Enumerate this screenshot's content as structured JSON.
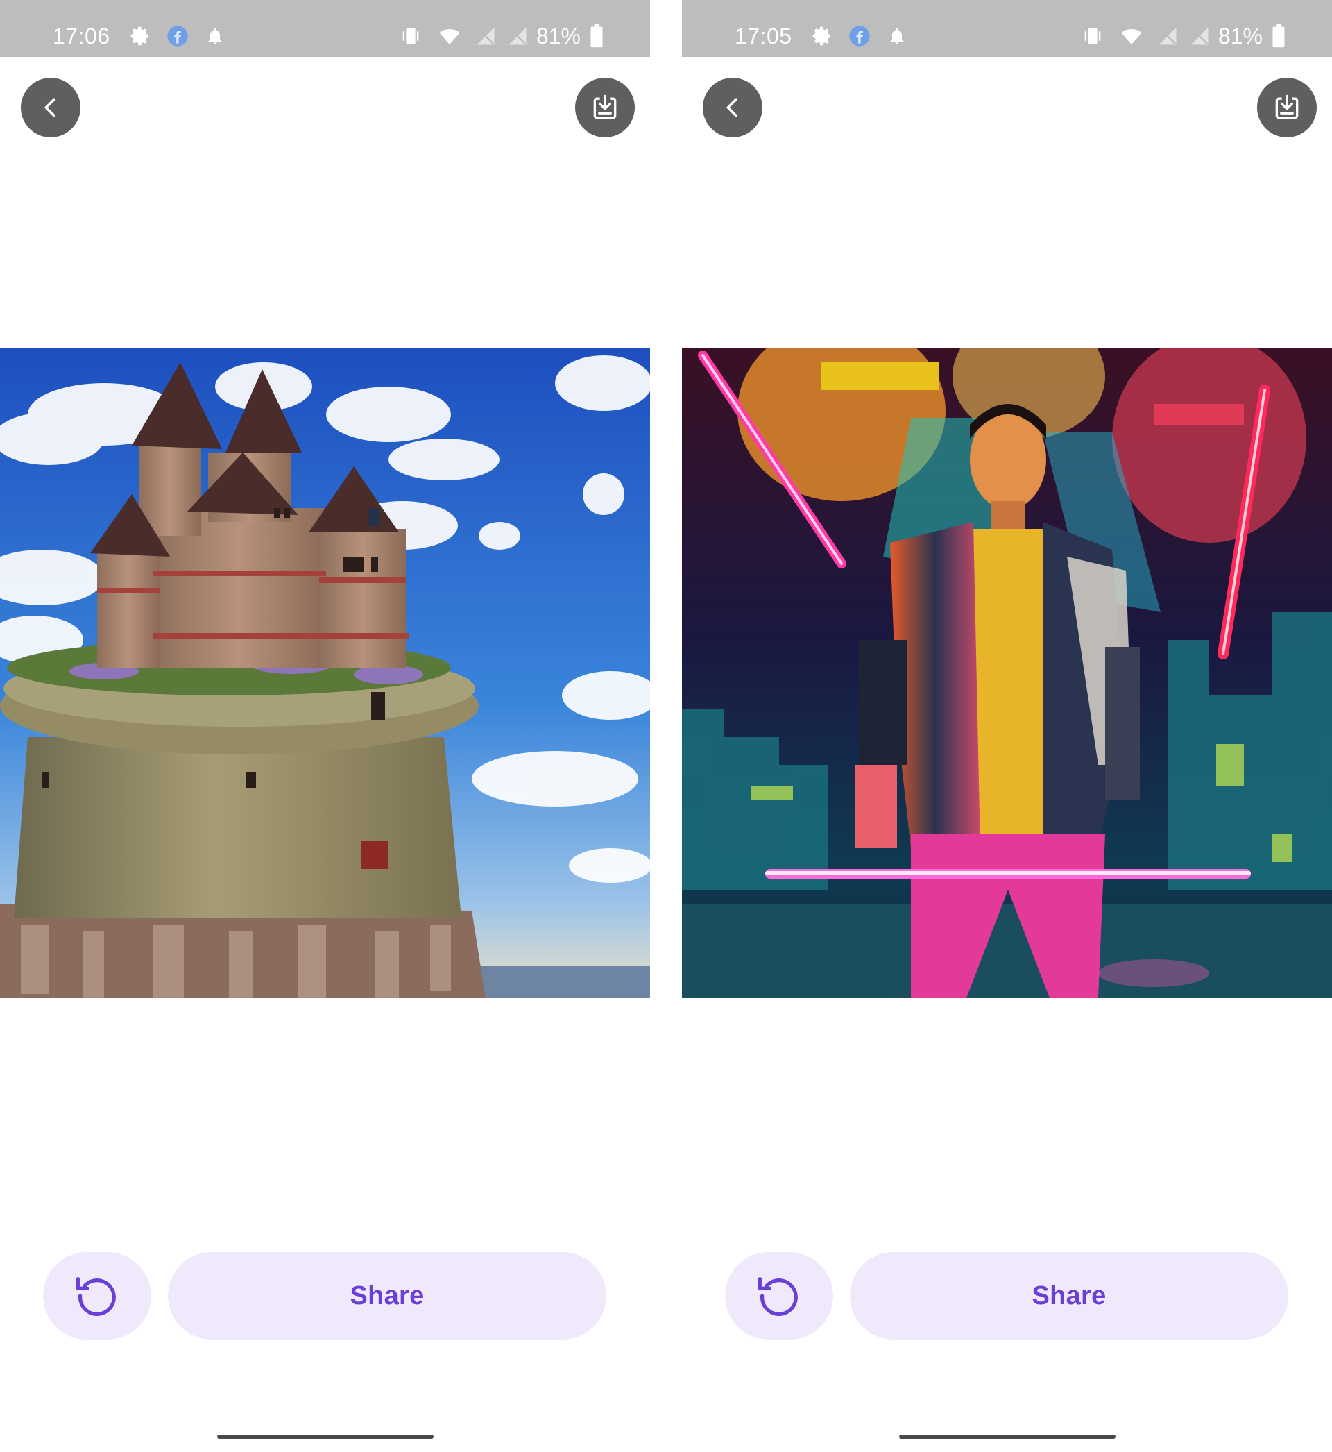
{
  "colors": {
    "status_bar_bg": "#bdbdbd",
    "accent": "#6a3fd6",
    "button_bg": "#efe9fb",
    "round_button_bg": "#5f5f5f",
    "facebook_blue": "#6f9fe8"
  },
  "screens": [
    {
      "status_bar": {
        "time": "17:06",
        "battery": "81%",
        "icons": [
          "gear-icon",
          "facebook-icon",
          "notification-bell-icon",
          "vibrate-icon",
          "wifi-icon",
          "signal-off-icon",
          "signal-off-icon",
          "battery-icon"
        ]
      },
      "toolbar": {
        "back_icon": "chevron-left-icon",
        "download_icon": "download-icon"
      },
      "artwork": {
        "subject": "castle"
      },
      "actions": {
        "regenerate_icon": "refresh-icon",
        "share_label": "Share"
      }
    },
    {
      "status_bar": {
        "time": "17:05",
        "battery": "81%",
        "icons": [
          "gear-icon",
          "facebook-icon",
          "notification-bell-icon",
          "vibrate-icon",
          "wifi-icon",
          "signal-off-icon",
          "signal-off-icon",
          "battery-icon"
        ]
      },
      "toolbar": {
        "back_icon": "chevron-left-icon",
        "download_icon": "download-icon"
      },
      "artwork": {
        "subject": "cyberpunk"
      },
      "actions": {
        "regenerate_icon": "refresh-icon",
        "share_label": "Share"
      }
    }
  ]
}
